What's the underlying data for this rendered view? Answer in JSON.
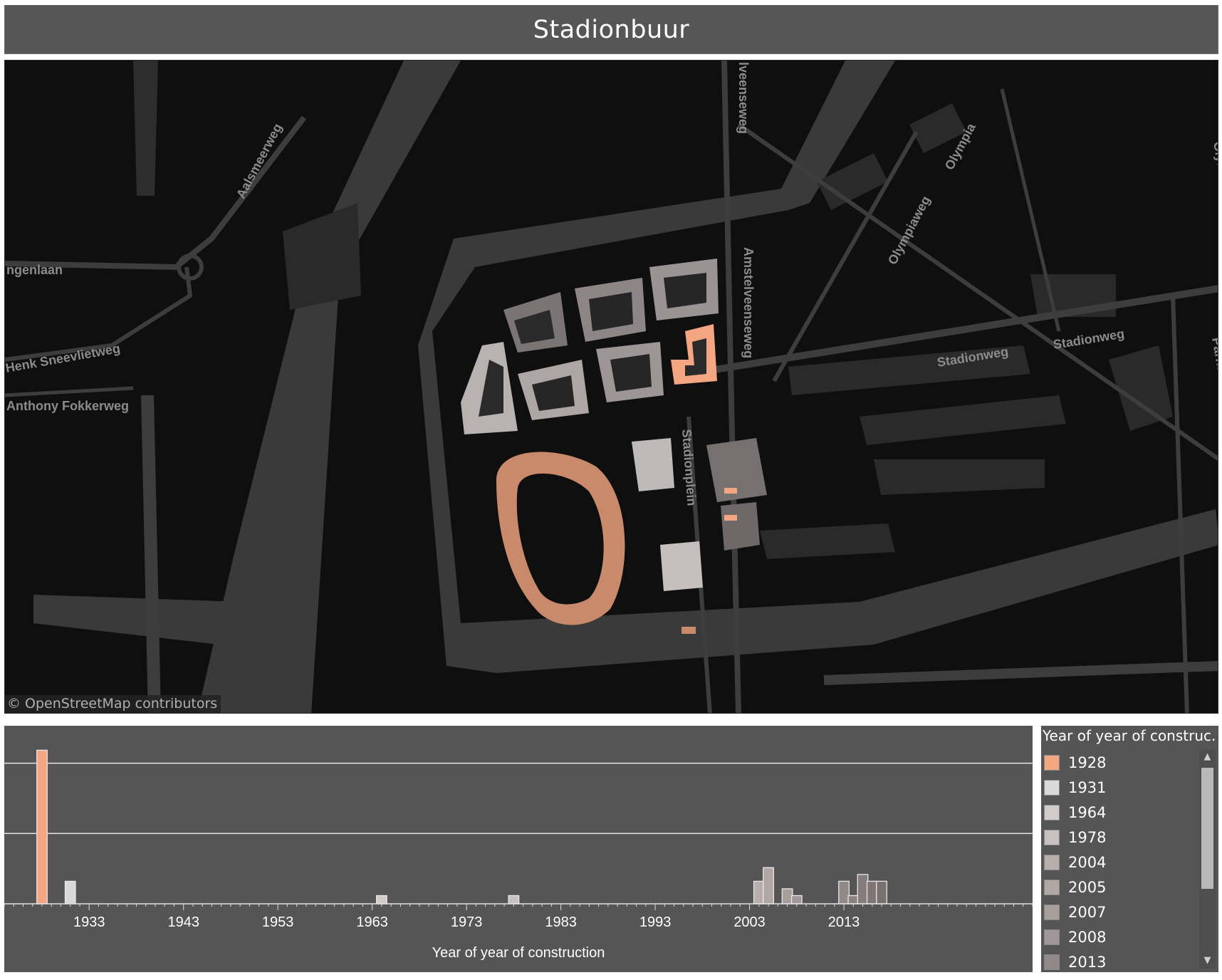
{
  "title": "Stadionbuur",
  "map": {
    "attribution": "© OpenStreetMap contributors",
    "street_labels": [
      "Aalsmeerweg",
      "ngenlaan",
      "Henk Sneevlietweg",
      "Anthony Fokkerweg",
      "Amstelveenseweg",
      "lveenseweg",
      "Olympiaweg",
      "Olympia",
      "Stadionweg",
      "Stadionweg",
      "Stadionplein",
      "Parnassusw",
      "Olym"
    ]
  },
  "chart_data": {
    "type": "bar",
    "title": "",
    "xlabel": "Year of year of construction",
    "ylabel": "",
    "xlim": [
      1924,
      2033
    ],
    "x_ticks": [
      1933,
      1943,
      1953,
      1963,
      1973,
      1983,
      1993,
      2003,
      2013
    ],
    "x_tick_labels": [
      "1933",
      "1943",
      "1953",
      "1963",
      "1973",
      "1983",
      "1993",
      "2003",
      "2013"
    ],
    "gridlines_y": 2,
    "series": [
      {
        "values": [
          {
            "year": 1928,
            "value": 22.5,
            "color": "#f4a582"
          },
          {
            "year": 1931,
            "value": 3.3,
            "color": "#d9d9d9"
          },
          {
            "year": 1964,
            "value": 1.2,
            "color": "#d2cbca"
          },
          {
            "year": 1978,
            "value": 1.2,
            "color": "#c9c1bf"
          },
          {
            "year": 2004,
            "value": 3.3,
            "color": "#b8aeac"
          },
          {
            "year": 2005,
            "value": 5.3,
            "color": "#b0a6a4"
          },
          {
            "year": 2007,
            "value": 2.2,
            "color": "#a89e9c"
          },
          {
            "year": 2008,
            "value": 1.2,
            "color": "#a1979a"
          },
          {
            "year": 2013,
            "value": 3.3,
            "color": "#928888"
          },
          {
            "year": 2014,
            "value": 1.2,
            "color": "#8c8282"
          },
          {
            "year": 2015,
            "value": 4.3,
            "color": "#857b7b"
          },
          {
            "year": 2016,
            "value": 3.3,
            "color": "#7f7575"
          },
          {
            "year": 2017,
            "value": 3.3,
            "color": "#7a7070"
          }
        ]
      }
    ]
  },
  "legend": {
    "title": "Year of year of construc...",
    "items": [
      {
        "label": "1928",
        "color": "#f4a582"
      },
      {
        "label": "1931",
        "color": "#d9d9d9"
      },
      {
        "label": "1964",
        "color": "#d2cbca"
      },
      {
        "label": "1978",
        "color": "#c9c1bf"
      },
      {
        "label": "2004",
        "color": "#b8aeac"
      },
      {
        "label": "2005",
        "color": "#b0a6a4"
      },
      {
        "label": "2007",
        "color": "#a89e9c"
      },
      {
        "label": "2008",
        "color": "#a1979a"
      },
      {
        "label": "2013",
        "color": "#928888"
      }
    ],
    "scroll_up_icon": "triangle-up-icon",
    "scroll_down_icon": "triangle-down-icon"
  }
}
